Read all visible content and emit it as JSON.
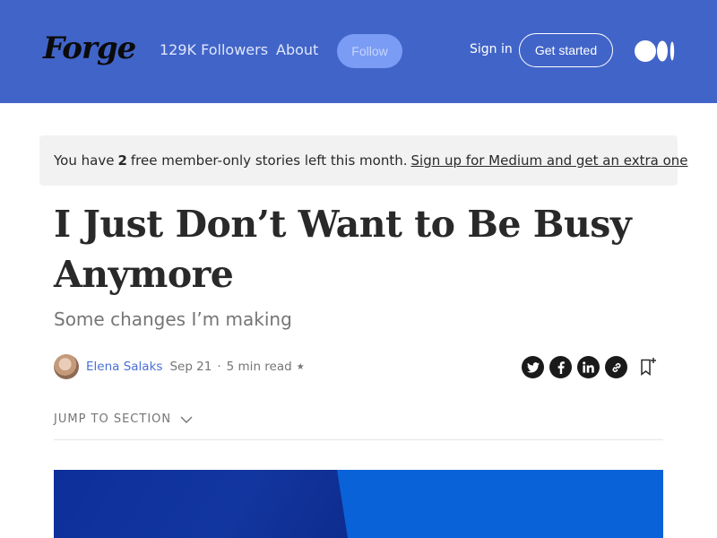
{
  "header": {
    "logo": "Forge",
    "followers": "129K Followers",
    "about": "About",
    "follow_label": "Follow",
    "signin_label": "Sign in",
    "getstarted_label": "Get started",
    "background_color": "#4164c8"
  },
  "banner": {
    "prefix": "You have",
    "count": "2",
    "suffix": "free member-only stories left this month.",
    "link_text": "Sign up for Medium and get an extra one"
  },
  "article": {
    "title": "I Just Don’t Want to Be Busy Anymore",
    "subtitle": "Some changes I’m making",
    "author": "Elena Salaks",
    "date": "Sep 21",
    "read_time": "5 min read",
    "member_star": "★"
  },
  "jump": {
    "label": "JUMP TO SECTION"
  },
  "icons": {
    "share": [
      "twitter-icon",
      "facebook-icon",
      "linkedin-icon",
      "link-icon"
    ],
    "bookmark": "bookmark-add-icon",
    "medium_logo": "medium-logo-icon"
  },
  "colors": {
    "accent_link": "#4a70d9",
    "hero_dark": "#12369f",
    "hero_light": "#0a62d8"
  }
}
